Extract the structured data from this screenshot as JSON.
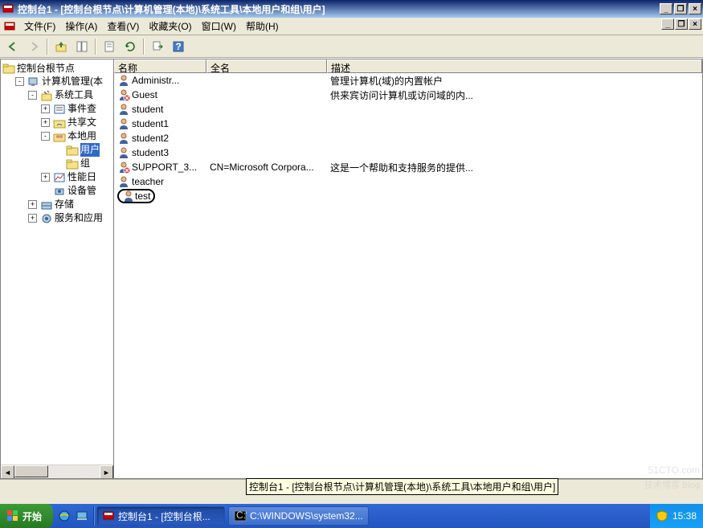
{
  "window": {
    "title": "控制台1 - [控制台根节点\\计算机管理(本地)\\系统工具\\本地用户和组\\用户]"
  },
  "menus": {
    "file": "文件(F)",
    "action": "操作(A)",
    "view": "查看(V)",
    "favorites": "收藏夹(O)",
    "window": "窗口(W)",
    "help": "帮助(H)"
  },
  "tree": {
    "root": "控制台根节点",
    "mgmt": "计算机管理(本",
    "systools": "系统工具",
    "eventv": "事件查",
    "shared": "共享文",
    "localug": "本地用",
    "users": "用户",
    "groups": "组",
    "perf": "性能日",
    "devmgr": "设备管",
    "storage": "存储",
    "services": "服务和应用"
  },
  "columns": {
    "name": "名称",
    "fullname": "全名",
    "desc": "描述"
  },
  "users": [
    {
      "name": "Administr...",
      "full": "",
      "desc": "管理计算机(域)的内置帐户",
      "disabled": false
    },
    {
      "name": "Guest",
      "full": "",
      "desc": "供来宾访问计算机或访问域的内...",
      "disabled": true
    },
    {
      "name": "student",
      "full": "",
      "desc": "",
      "disabled": false
    },
    {
      "name": "student1",
      "full": "",
      "desc": "",
      "disabled": false
    },
    {
      "name": "student2",
      "full": "",
      "desc": "",
      "disabled": false
    },
    {
      "name": "student3",
      "full": "",
      "desc": "",
      "disabled": false
    },
    {
      "name": "SUPPORT_3...",
      "full": "CN=Microsoft Corpora...",
      "desc": "这是一个帮助和支持服务的提供...",
      "disabled": true
    },
    {
      "name": "teacher",
      "full": "",
      "desc": "",
      "disabled": false
    },
    {
      "name": "test",
      "full": "",
      "desc": "",
      "disabled": false,
      "circled": true
    }
  ],
  "tooltip": "控制台1 - [控制台根节点\\计算机管理(本地)\\系统工具\\本地用户和组\\用户]",
  "taskbar": {
    "start": "开始",
    "task1": "控制台1 - [控制台根...",
    "task2": "C:\\WINDOWS\\system32...",
    "clock": "15:38"
  },
  "watermark": {
    "big": "51CTO.com",
    "small": "技术博客  Blog"
  }
}
